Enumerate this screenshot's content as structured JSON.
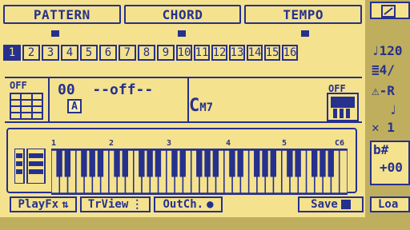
{
  "tabs": {
    "pattern": "PATTERN",
    "chord": "CHORD",
    "tempo": "TEMPO"
  },
  "steps": [
    "1",
    "2",
    "3",
    "4",
    "5",
    "6",
    "7",
    "8",
    "9",
    "10",
    "11",
    "12",
    "13",
    "14",
    "15",
    "16"
  ],
  "info": {
    "left_off": "OFF",
    "pattern_value": "00  --off--",
    "bank_label": "A",
    "chord_name": "C",
    "chord_suffix": "M7",
    "right_off": "OFF"
  },
  "keyboard": {
    "octave_labels": [
      "1",
      "2",
      "3",
      "4",
      "5",
      "C6"
    ]
  },
  "buttons": {
    "playfx": "PlayFx",
    "trview": "TrView",
    "outch": "OutCh.",
    "save": "Save"
  },
  "right_panel": {
    "tempo": "120",
    "meter": "4/",
    "r_label": "R",
    "one": "1",
    "key": "b#",
    "plus": "+00",
    "load": "Loa"
  },
  "colors": {
    "background": "#f4e28e",
    "foreground": "#26308d"
  }
}
